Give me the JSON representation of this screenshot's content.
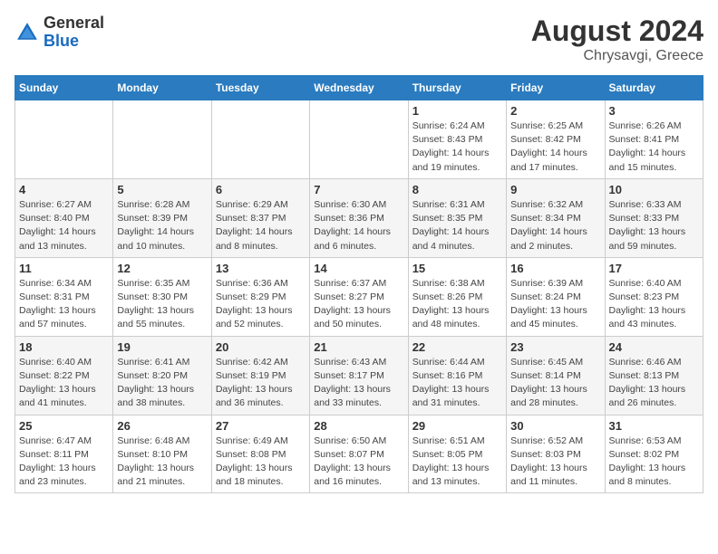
{
  "header": {
    "logo_line1": "General",
    "logo_line2": "Blue",
    "month_year": "August 2024",
    "location": "Chrysavgi, Greece"
  },
  "weekdays": [
    "Sunday",
    "Monday",
    "Tuesday",
    "Wednesday",
    "Thursday",
    "Friday",
    "Saturday"
  ],
  "weeks": [
    [
      {
        "day": "",
        "info": ""
      },
      {
        "day": "",
        "info": ""
      },
      {
        "day": "",
        "info": ""
      },
      {
        "day": "",
        "info": ""
      },
      {
        "day": "1",
        "info": "Sunrise: 6:24 AM\nSunset: 8:43 PM\nDaylight: 14 hours\nand 19 minutes."
      },
      {
        "day": "2",
        "info": "Sunrise: 6:25 AM\nSunset: 8:42 PM\nDaylight: 14 hours\nand 17 minutes."
      },
      {
        "day": "3",
        "info": "Sunrise: 6:26 AM\nSunset: 8:41 PM\nDaylight: 14 hours\nand 15 minutes."
      }
    ],
    [
      {
        "day": "4",
        "info": "Sunrise: 6:27 AM\nSunset: 8:40 PM\nDaylight: 14 hours\nand 13 minutes."
      },
      {
        "day": "5",
        "info": "Sunrise: 6:28 AM\nSunset: 8:39 PM\nDaylight: 14 hours\nand 10 minutes."
      },
      {
        "day": "6",
        "info": "Sunrise: 6:29 AM\nSunset: 8:37 PM\nDaylight: 14 hours\nand 8 minutes."
      },
      {
        "day": "7",
        "info": "Sunrise: 6:30 AM\nSunset: 8:36 PM\nDaylight: 14 hours\nand 6 minutes."
      },
      {
        "day": "8",
        "info": "Sunrise: 6:31 AM\nSunset: 8:35 PM\nDaylight: 14 hours\nand 4 minutes."
      },
      {
        "day": "9",
        "info": "Sunrise: 6:32 AM\nSunset: 8:34 PM\nDaylight: 14 hours\nand 2 minutes."
      },
      {
        "day": "10",
        "info": "Sunrise: 6:33 AM\nSunset: 8:33 PM\nDaylight: 13 hours\nand 59 minutes."
      }
    ],
    [
      {
        "day": "11",
        "info": "Sunrise: 6:34 AM\nSunset: 8:31 PM\nDaylight: 13 hours\nand 57 minutes."
      },
      {
        "day": "12",
        "info": "Sunrise: 6:35 AM\nSunset: 8:30 PM\nDaylight: 13 hours\nand 55 minutes."
      },
      {
        "day": "13",
        "info": "Sunrise: 6:36 AM\nSunset: 8:29 PM\nDaylight: 13 hours\nand 52 minutes."
      },
      {
        "day": "14",
        "info": "Sunrise: 6:37 AM\nSunset: 8:27 PM\nDaylight: 13 hours\nand 50 minutes."
      },
      {
        "day": "15",
        "info": "Sunrise: 6:38 AM\nSunset: 8:26 PM\nDaylight: 13 hours\nand 48 minutes."
      },
      {
        "day": "16",
        "info": "Sunrise: 6:39 AM\nSunset: 8:24 PM\nDaylight: 13 hours\nand 45 minutes."
      },
      {
        "day": "17",
        "info": "Sunrise: 6:40 AM\nSunset: 8:23 PM\nDaylight: 13 hours\nand 43 minutes."
      }
    ],
    [
      {
        "day": "18",
        "info": "Sunrise: 6:40 AM\nSunset: 8:22 PM\nDaylight: 13 hours\nand 41 minutes."
      },
      {
        "day": "19",
        "info": "Sunrise: 6:41 AM\nSunset: 8:20 PM\nDaylight: 13 hours\nand 38 minutes."
      },
      {
        "day": "20",
        "info": "Sunrise: 6:42 AM\nSunset: 8:19 PM\nDaylight: 13 hours\nand 36 minutes."
      },
      {
        "day": "21",
        "info": "Sunrise: 6:43 AM\nSunset: 8:17 PM\nDaylight: 13 hours\nand 33 minutes."
      },
      {
        "day": "22",
        "info": "Sunrise: 6:44 AM\nSunset: 8:16 PM\nDaylight: 13 hours\nand 31 minutes."
      },
      {
        "day": "23",
        "info": "Sunrise: 6:45 AM\nSunset: 8:14 PM\nDaylight: 13 hours\nand 28 minutes."
      },
      {
        "day": "24",
        "info": "Sunrise: 6:46 AM\nSunset: 8:13 PM\nDaylight: 13 hours\nand 26 minutes."
      }
    ],
    [
      {
        "day": "25",
        "info": "Sunrise: 6:47 AM\nSunset: 8:11 PM\nDaylight: 13 hours\nand 23 minutes."
      },
      {
        "day": "26",
        "info": "Sunrise: 6:48 AM\nSunset: 8:10 PM\nDaylight: 13 hours\nand 21 minutes."
      },
      {
        "day": "27",
        "info": "Sunrise: 6:49 AM\nSunset: 8:08 PM\nDaylight: 13 hours\nand 18 minutes."
      },
      {
        "day": "28",
        "info": "Sunrise: 6:50 AM\nSunset: 8:07 PM\nDaylight: 13 hours\nand 16 minutes."
      },
      {
        "day": "29",
        "info": "Sunrise: 6:51 AM\nSunset: 8:05 PM\nDaylight: 13 hours\nand 13 minutes."
      },
      {
        "day": "30",
        "info": "Sunrise: 6:52 AM\nSunset: 8:03 PM\nDaylight: 13 hours\nand 11 minutes."
      },
      {
        "day": "31",
        "info": "Sunrise: 6:53 AM\nSunset: 8:02 PM\nDaylight: 13 hours\nand 8 minutes."
      }
    ]
  ]
}
